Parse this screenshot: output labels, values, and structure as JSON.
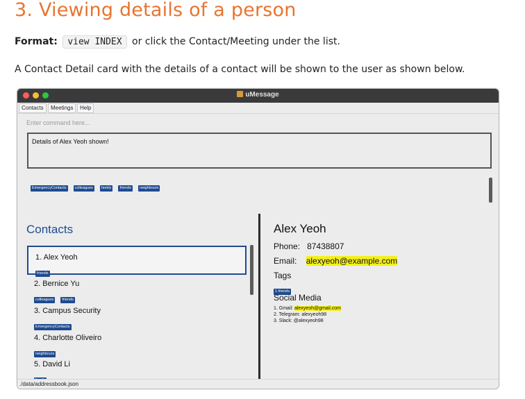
{
  "doc": {
    "heading": "3. Viewing details of a person",
    "format_label": "Format:",
    "format_code": "view INDEX",
    "format_rest": " or click the Contact/Meeting under the list.",
    "paragraph": "A Contact Detail card with the details of a contact will be shown to the user as shown below."
  },
  "app": {
    "window_title": "uMessage",
    "menu": [
      "Contacts",
      "Meetings",
      "Help"
    ],
    "command_placeholder": "Enter command here...",
    "result_text": "Details of Alex Yeoh shown!",
    "tag_filters": [
      "EmergencyContacts",
      "colleagues",
      "family",
      "friends",
      "neighbours"
    ],
    "list_title": "Contacts",
    "contacts": [
      {
        "name": "1.  Alex Yeoh",
        "tags": [
          "friends"
        ]
      },
      {
        "name": "2.  Bernice Yu",
        "tags": [
          "colleagues",
          "friends"
        ]
      },
      {
        "name": "3.  Campus Security",
        "tags": [
          "EmergencyContacts"
        ]
      },
      {
        "name": "4.  Charlotte Oliveiro",
        "tags": [
          "neighbours"
        ]
      },
      {
        "name": "5.  David Li",
        "tags": [
          "family"
        ]
      }
    ],
    "detail": {
      "name": "Alex Yeoh",
      "phone_label": "Phone:",
      "phone": "87438807",
      "email_label": "Email:",
      "email": "alexyeoh@example.com",
      "tags_label": "Tags",
      "tags": [
        "1.friends"
      ],
      "social_label": "Social Media",
      "social": {
        "gmail_prefix": "1. Gmail: ",
        "gmail": "alexyeoh@gmail.com",
        "telegram": "2. Telegram: alexyeoh98",
        "slack": "3. Slack: @alexyeoh98"
      }
    },
    "status_path": "./data/addressbook.json"
  },
  "colors": {
    "heading": "#e8742f",
    "tag_bg": "#1f4a8f",
    "highlight": "#f4f01a"
  }
}
